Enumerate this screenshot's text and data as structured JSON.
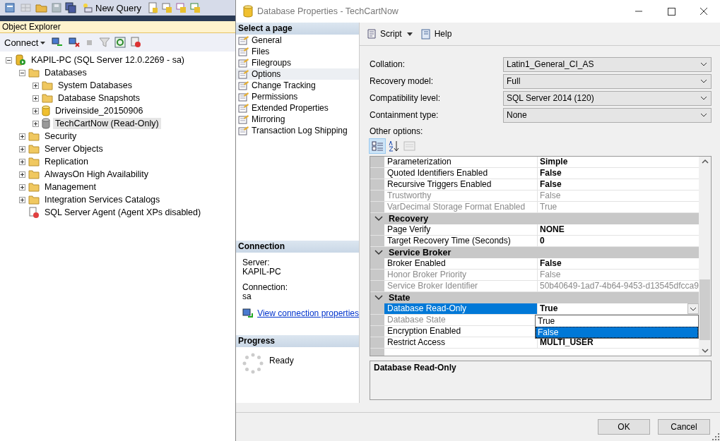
{
  "main_toolbar": {
    "new_query": "New Query"
  },
  "object_explorer": {
    "title": "Object Explorer",
    "connect": "Connect",
    "tree": [
      {
        "label": "KAPIL-PC (SQL Server 12.0.2269 - sa)",
        "kind": "server",
        "expanded": true,
        "selected": false,
        "children": [
          {
            "label": "Databases",
            "kind": "folder",
            "expanded": true,
            "selected": false,
            "children": [
              {
                "label": "System Databases",
                "kind": "folder",
                "expanded": false,
                "selected": false
              },
              {
                "label": "Database Snapshots",
                "kind": "folder",
                "expanded": false,
                "selected": false
              },
              {
                "label": "Driveinside_20150906",
                "kind": "database",
                "expanded": false,
                "selected": false
              },
              {
                "label": "TechCartNow (Read-Only)",
                "kind": "database_readonly",
                "expanded": false,
                "selected": true
              }
            ]
          },
          {
            "label": "Security",
            "kind": "folder",
            "expanded": false,
            "selected": false
          },
          {
            "label": "Server Objects",
            "kind": "folder",
            "expanded": false,
            "selected": false
          },
          {
            "label": "Replication",
            "kind": "folder",
            "expanded": false,
            "selected": false
          },
          {
            "label": "AlwaysOn High Availability",
            "kind": "folder",
            "expanded": false,
            "selected": false
          },
          {
            "label": "Management",
            "kind": "folder",
            "expanded": false,
            "selected": false
          },
          {
            "label": "Integration Services Catalogs",
            "kind": "folder",
            "expanded": false,
            "selected": false
          },
          {
            "label": "SQL Server Agent (Agent XPs disabled)",
            "kind": "agent",
            "selected": false
          }
        ]
      }
    ]
  },
  "dialog": {
    "title": "Database Properties - TechCartNow",
    "select_page": {
      "header": "Select a page",
      "pages": [
        {
          "label": "General",
          "selected": false
        },
        {
          "label": "Files",
          "selected": false
        },
        {
          "label": "Filegroups",
          "selected": false
        },
        {
          "label": "Options",
          "selected": true
        },
        {
          "label": "Change Tracking",
          "selected": false
        },
        {
          "label": "Permissions",
          "selected": false
        },
        {
          "label": "Extended Properties",
          "selected": false
        },
        {
          "label": "Mirroring",
          "selected": false
        },
        {
          "label": "Transaction Log Shipping",
          "selected": false
        }
      ]
    },
    "connection": {
      "header": "Connection",
      "server_label": "Server:",
      "server": "KAPIL-PC",
      "connection_label": "Connection:",
      "connection": "sa",
      "link": "View connection properties"
    },
    "progress": {
      "header": "Progress",
      "status": "Ready"
    },
    "toolbar": {
      "script": "Script",
      "help": "Help"
    },
    "fields": [
      {
        "label": "Collation:",
        "value": "Latin1_General_CI_AS"
      },
      {
        "label": "Recovery model:",
        "value": "Full"
      },
      {
        "label": "Compatibility level:",
        "value": "SQL Server 2014 (120)"
      },
      {
        "label": "Containment type:",
        "value": "None"
      }
    ],
    "other_options": "Other options:",
    "grid": {
      "categorized": true,
      "groups": [
        {
          "rows": [
            {
              "name": "Parameterization",
              "value": "Simple",
              "modified": true,
              "disabled": false,
              "selected": false
            },
            {
              "name": "Quoted Identifiers Enabled",
              "value": "False",
              "modified": true,
              "disabled": false,
              "selected": false
            },
            {
              "name": "Recursive Triggers Enabled",
              "value": "False",
              "modified": true,
              "disabled": false,
              "selected": false
            },
            {
              "name": "Trustworthy",
              "value": "False",
              "modified": false,
              "disabled": true,
              "selected": false
            },
            {
              "name": "VarDecimal Storage Format Enabled",
              "value": "True",
              "modified": false,
              "disabled": true,
              "selected": false
            }
          ]
        },
        {
          "name": "Recovery",
          "expanded": true,
          "rows": [
            {
              "name": "Page Verify",
              "value": "NONE",
              "modified": true,
              "disabled": false,
              "selected": false
            },
            {
              "name": "Target Recovery Time (Seconds)",
              "value": "0",
              "modified": true,
              "disabled": false,
              "selected": false
            }
          ]
        },
        {
          "name": "Service Broker",
          "expanded": true,
          "rows": [
            {
              "name": "Broker Enabled",
              "value": "False",
              "modified": true,
              "disabled": false,
              "selected": false
            },
            {
              "name": "Honor Broker Priority",
              "value": "False",
              "modified": false,
              "disabled": true,
              "selected": false
            },
            {
              "name": "Service Broker Identifier",
              "value": "50b40649-1ad7-4b64-9453-d13545dfcca9",
              "modified": false,
              "disabled": true,
              "selected": false
            }
          ]
        },
        {
          "name": "State",
          "expanded": true,
          "rows": [
            {
              "name": "Database Read-Only",
              "value": "True",
              "modified": true,
              "disabled": false,
              "selected": true
            },
            {
              "name": "Database State",
              "disabled": true,
              "selected": false
            },
            {
              "name": "Encryption Enabled",
              "disabled": false,
              "selected": false
            },
            {
              "name": "Restrict Access",
              "value": "MULTI_USER",
              "modified": true,
              "disabled": false,
              "selected": false
            }
          ]
        }
      ],
      "dropdown": [
        {
          "label": "True",
          "selected": false
        },
        {
          "label": "False",
          "selected": true
        }
      ]
    },
    "description": "Database Read-Only",
    "buttons": [
      "OK",
      "Cancel"
    ]
  }
}
